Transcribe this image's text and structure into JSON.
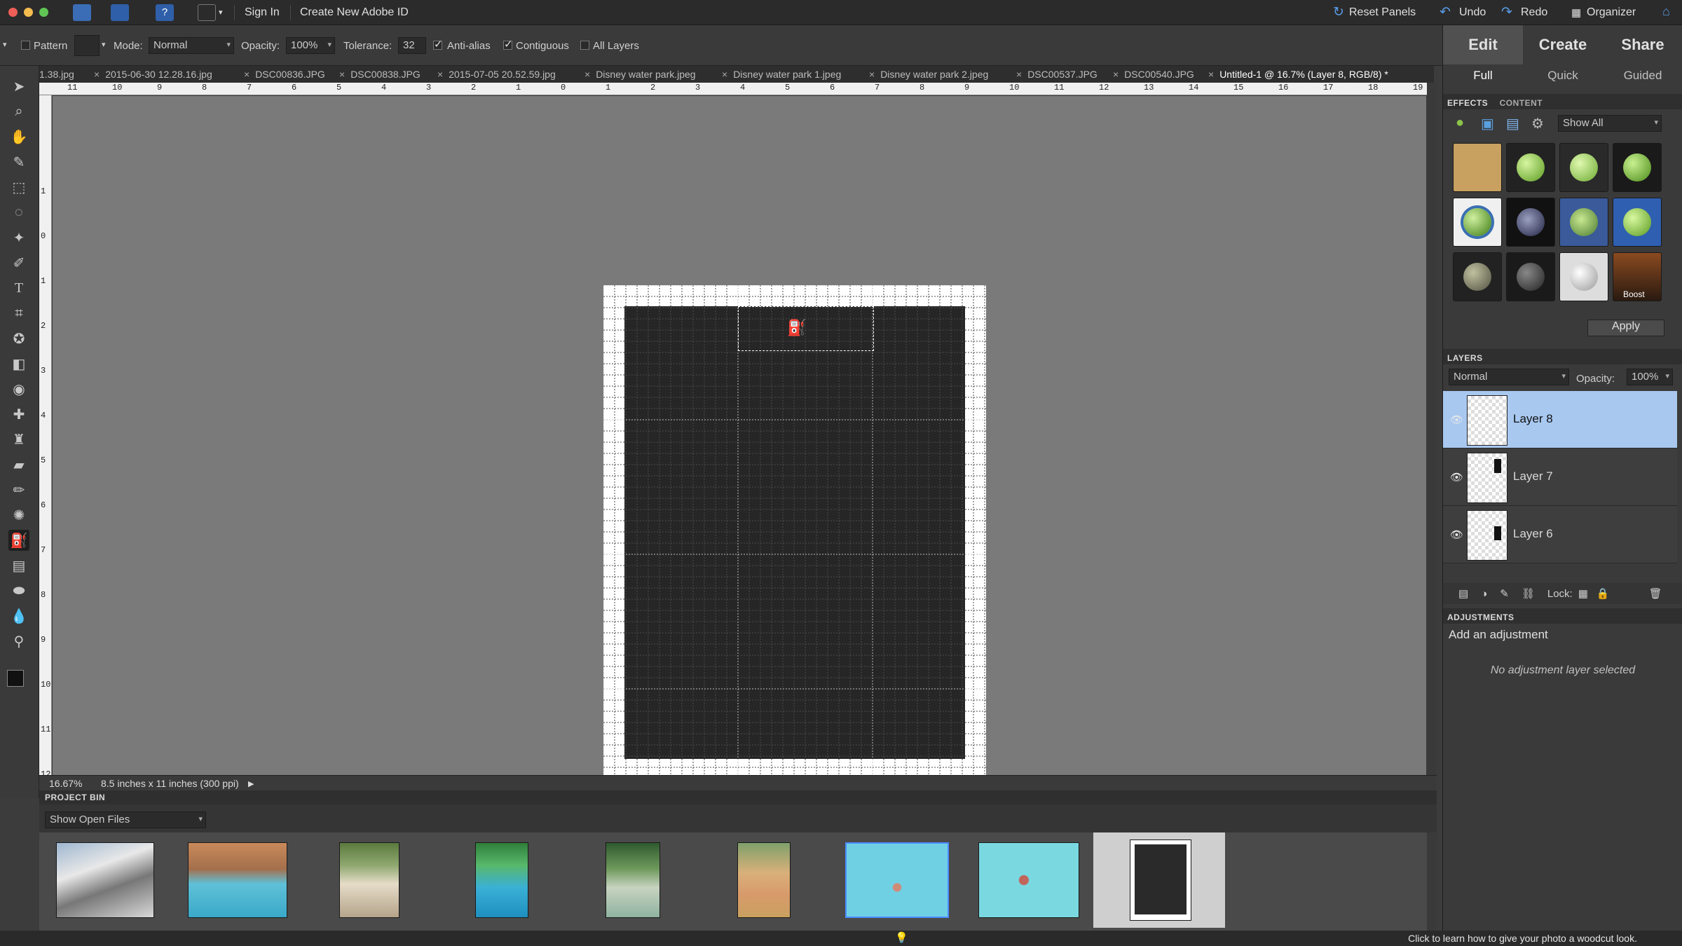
{
  "menubar": {
    "sign_in": "Sign In",
    "create_id": "Create New Adobe ID",
    "reset_panels": "Reset Panels",
    "undo": "Undo",
    "redo": "Redo",
    "organizer": "Organizer"
  },
  "options": {
    "pattern_label": "Pattern",
    "mode_label": "Mode:",
    "mode_value": "Normal",
    "opacity_label": "Opacity:",
    "opacity_value": "100%",
    "tolerance_label": "Tolerance:",
    "tolerance_value": "32",
    "anti_alias": "Anti-alias",
    "contiguous": "Contiguous",
    "all_layers": "All Layers"
  },
  "doc_tabs": [
    {
      "label": "1.38.jpg"
    },
    {
      "label": "2015-06-30 12.28.16.jpg"
    },
    {
      "label": "DSC00836.JPG"
    },
    {
      "label": "DSC00838.JPG"
    },
    {
      "label": "2015-07-05 20.52.59.jpg"
    },
    {
      "label": "Disney water park.jpeg"
    },
    {
      "label": "Disney water park 1.jpeg"
    },
    {
      "label": "Disney water park 2.jpeg"
    },
    {
      "label": "DSC00537.JPG"
    },
    {
      "label": "DSC00540.JPG"
    },
    {
      "label": "Untitled-1 @ 16.7% (Layer 8, RGB/8) *"
    }
  ],
  "ruler": {
    "h_numbers": [
      "11",
      "10",
      "9",
      "8",
      "7",
      "6",
      "5",
      "4",
      "3",
      "2",
      "1",
      "0",
      "1",
      "2",
      "3",
      "4",
      "5",
      "6",
      "7",
      "8",
      "9",
      "10",
      "11",
      "12",
      "13",
      "14",
      "15",
      "16",
      "17",
      "18",
      "19"
    ],
    "v_numbers": [
      "1",
      "0",
      "1",
      "2",
      "3",
      "4",
      "5",
      "6",
      "7",
      "8",
      "9",
      "10",
      "11",
      "12"
    ]
  },
  "status": {
    "zoom": "16.67%",
    "doc_size": "8.5 inches x 11 inches (300 ppi)"
  },
  "project_bin": {
    "title": "PROJECT BIN",
    "dropdown": "Show Open Files"
  },
  "tip": {
    "text": "Click to learn how to give your photo a woodcut look."
  },
  "right_panel": {
    "modes": [
      "Edit",
      "Create",
      "Share"
    ],
    "sub_tabs": [
      "Full",
      "Quick",
      "Guided"
    ],
    "effects_tab": "EFFECTS",
    "content_tab": "CONTENT",
    "show_all": "Show All",
    "boost_label": "Boost",
    "apply": "Apply",
    "layers_title": "LAYERS",
    "blend_mode": "Normal",
    "opacity_label": "Opacity:",
    "opacity_value": "100%",
    "layers": [
      {
        "name": "Layer 8",
        "selected": true
      },
      {
        "name": "Layer 7",
        "selected": false
      },
      {
        "name": "Layer 6",
        "selected": false
      }
    ],
    "lock_label": "Lock:",
    "adjustments_title": "ADJUSTMENTS",
    "add_adjustment": "Add an adjustment",
    "no_adjustment": "No adjustment layer selected"
  },
  "colors": {
    "accent": "#4a8cff",
    "selected_layer": "#a8c8f0",
    "canvas_bg": "#7a7a7a",
    "layer_fill": "#262626"
  }
}
